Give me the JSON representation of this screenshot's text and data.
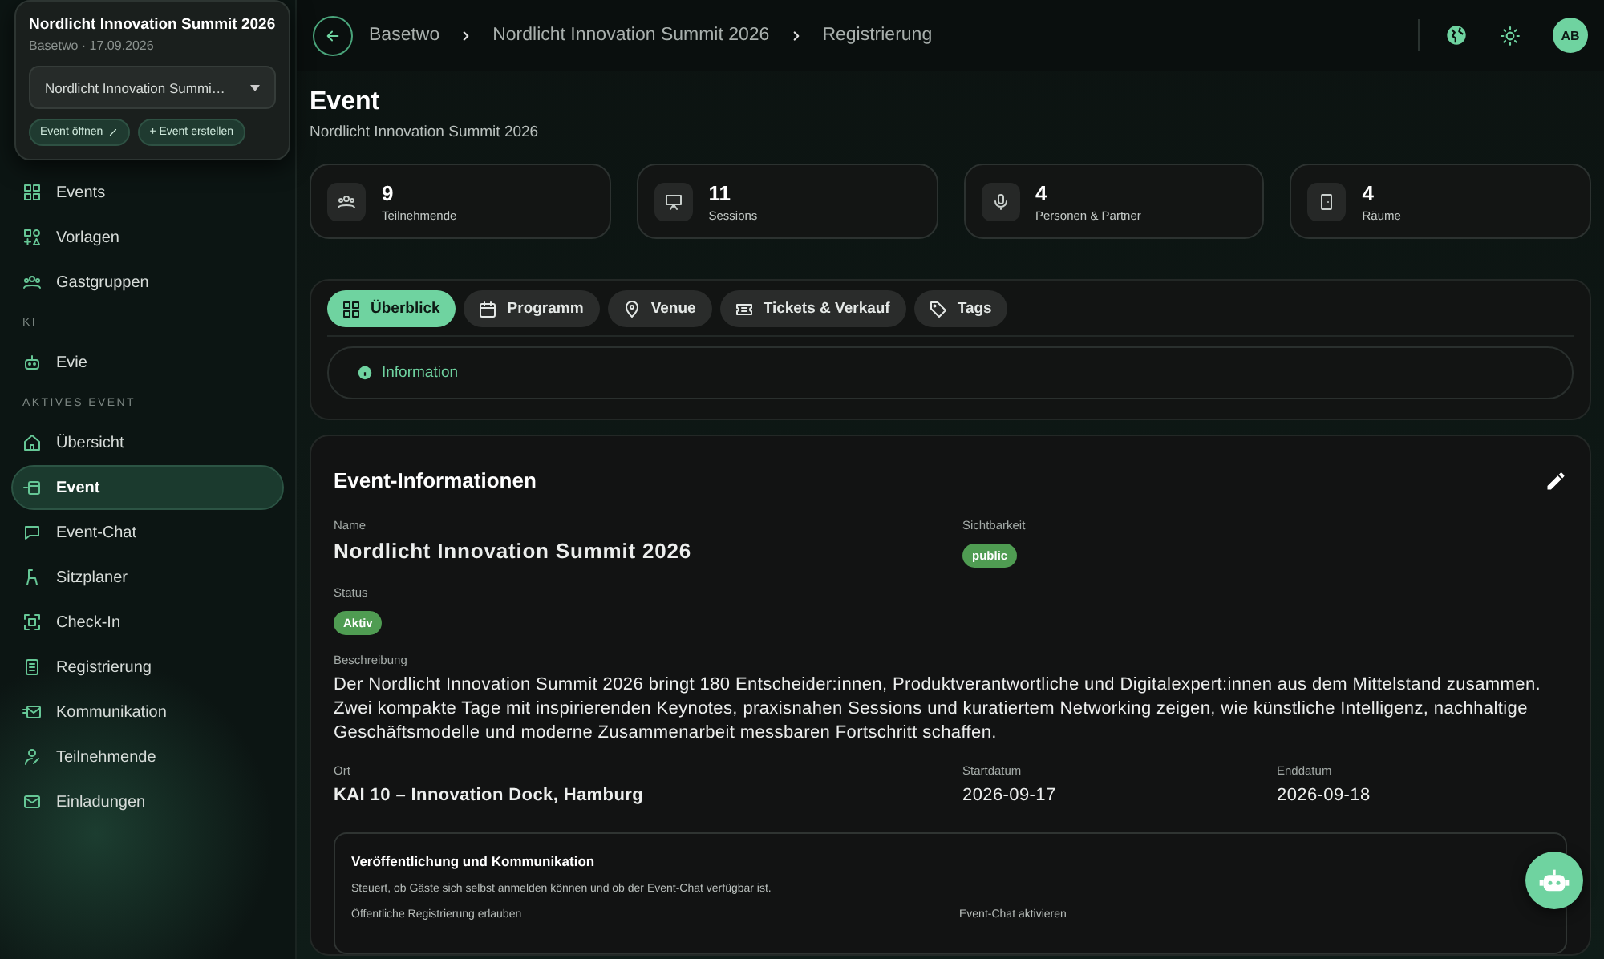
{
  "event_switcher": {
    "title": "Nordlicht Innovation Summit 2026",
    "subtitle": "Basetwo · 17.09.2026",
    "select_value": "Nordlicht Innovation Summi…",
    "buttons": [
      {
        "label": "Event öffnen",
        "kind": "open"
      },
      {
        "label": "+ Event erstellen",
        "kind": "create"
      }
    ]
  },
  "sidebar": {
    "items": [
      {
        "kind": "item",
        "label": "Events",
        "selected": false
      },
      {
        "kind": "item",
        "label": "Vorlagen",
        "selected": false
      },
      {
        "kind": "item",
        "label": "Gastgruppen",
        "selected": false
      },
      {
        "kind": "heading",
        "label": "KI"
      },
      {
        "kind": "item",
        "label": "Evie",
        "selected": false
      },
      {
        "kind": "heading",
        "label": "AKTIVES EVENT"
      },
      {
        "kind": "item",
        "label": "Übersicht",
        "selected": false
      },
      {
        "kind": "item",
        "label": "Event",
        "selected": true
      },
      {
        "kind": "item",
        "label": "Event-Chat",
        "selected": false
      },
      {
        "kind": "item",
        "label": "Sitzplaner",
        "selected": false
      },
      {
        "kind": "item",
        "label": "Check-In",
        "selected": false
      },
      {
        "kind": "item",
        "label": "Registrierung",
        "selected": false
      },
      {
        "kind": "item",
        "label": "Kommunikation",
        "selected": false
      },
      {
        "kind": "item",
        "label": "Teilnehmende",
        "selected": false
      },
      {
        "kind": "item",
        "label": "Einladungen",
        "selected": false
      }
    ]
  },
  "topbar": {
    "breadcrumbs": [
      "Basetwo",
      "Nordlicht Innovation Summit 2026",
      "Registrierung"
    ],
    "avatar": "AB"
  },
  "page": {
    "title": "Event",
    "subtitle": "Nordlicht Innovation Summit 2026"
  },
  "stats": [
    {
      "value": "9",
      "label": "Teilnehmende"
    },
    {
      "value": "11",
      "label": "Sessions"
    },
    {
      "value": "4",
      "label": "Personen & Partner"
    },
    {
      "value": "4",
      "label": "Räume"
    }
  ],
  "tabs": [
    {
      "label": "Überblick",
      "selected": true
    },
    {
      "label": "Programm",
      "selected": false
    },
    {
      "label": "Venue",
      "selected": false
    },
    {
      "label": "Tickets & Verkauf",
      "selected": false
    },
    {
      "label": "Tags",
      "selected": false
    }
  ],
  "info_banner": "Information",
  "event_info": {
    "title": "Event-Informationen",
    "rows": [
      [
        {
          "label": "Name",
          "value": "Nordlicht Innovation Summit 2026",
          "kind": "title"
        },
        {
          "label": "Sichtbarkeit",
          "value": "public",
          "kind": "badge"
        }
      ],
      [
        {
          "label": "Status",
          "value": "Aktiv",
          "kind": "badge"
        }
      ],
      [
        {
          "label": "Beschreibung",
          "value": "Der Nordlicht Innovation Summit 2026 bringt 180 Entscheider:innen, Produktverantwortliche und Digitalexpert:innen aus dem Mittelstand zusammen. Zwei kompakte Tage mit inspirierenden Keynotes, praxisnahen Sessions und kuratiertem Networking zeigen, wie künstliche Intelligenz, nachhaltige Geschäftsmodelle und moderne Zusammenarbeit messbaren Fortschritt schaffen.",
          "kind": "text"
        }
      ],
      [
        {
          "label": "Ort",
          "value": "KAI 10 – Innovation Dock, Hamburg",
          "kind": "strong"
        },
        {
          "label": "Startdatum",
          "value": "2026-09-17",
          "kind": "text"
        },
        {
          "label": "Enddatum",
          "value": "2026-09-18",
          "kind": "text"
        }
      ]
    ]
  },
  "publication": {
    "title": "Veröffentlichung und Kommunikation",
    "description": "Steuert, ob Gäste sich selbst anmelden können und ob der Event-Chat verfügbar ist.",
    "settings": [
      {
        "label": "Öffentliche Registrierung erlauben"
      },
      {
        "label": "Event-Chat aktivieren"
      }
    ]
  }
}
